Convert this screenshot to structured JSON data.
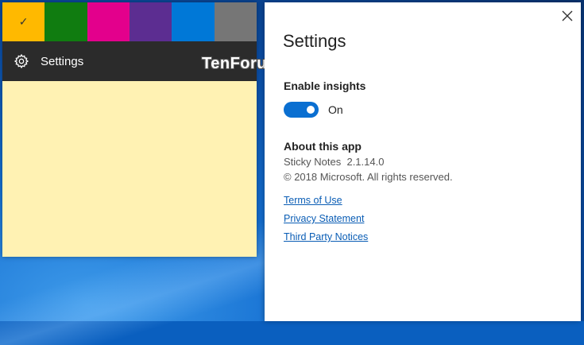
{
  "watermark": "TenForums.com",
  "note": {
    "background_color": "#fff2b3",
    "palette": [
      {
        "name": "yellow",
        "color": "#ffb900",
        "selected": true
      },
      {
        "name": "green",
        "color": "#107c10",
        "selected": false
      },
      {
        "name": "pink",
        "color": "#e3008c",
        "selected": false
      },
      {
        "name": "purple",
        "color": "#5c2d91",
        "selected": false
      },
      {
        "name": "blue",
        "color": "#0078d7",
        "selected": false
      },
      {
        "name": "gray",
        "color": "#767676",
        "selected": false
      }
    ],
    "check_glyph": "✓",
    "menu": {
      "icon": "gear-icon",
      "label": "Settings"
    }
  },
  "settings": {
    "title": "Settings",
    "close_icon": "close-icon",
    "insights": {
      "heading": "Enable insights",
      "state_label": "On",
      "enabled": true,
      "accent": "#0a6fd1"
    },
    "about": {
      "heading": "About this app",
      "version": "Sticky Notes  2.1.14.0",
      "copyright": "© 2018 Microsoft. All rights reserved."
    },
    "links": [
      "Terms of Use",
      "Privacy Statement",
      "Third Party Notices"
    ]
  }
}
